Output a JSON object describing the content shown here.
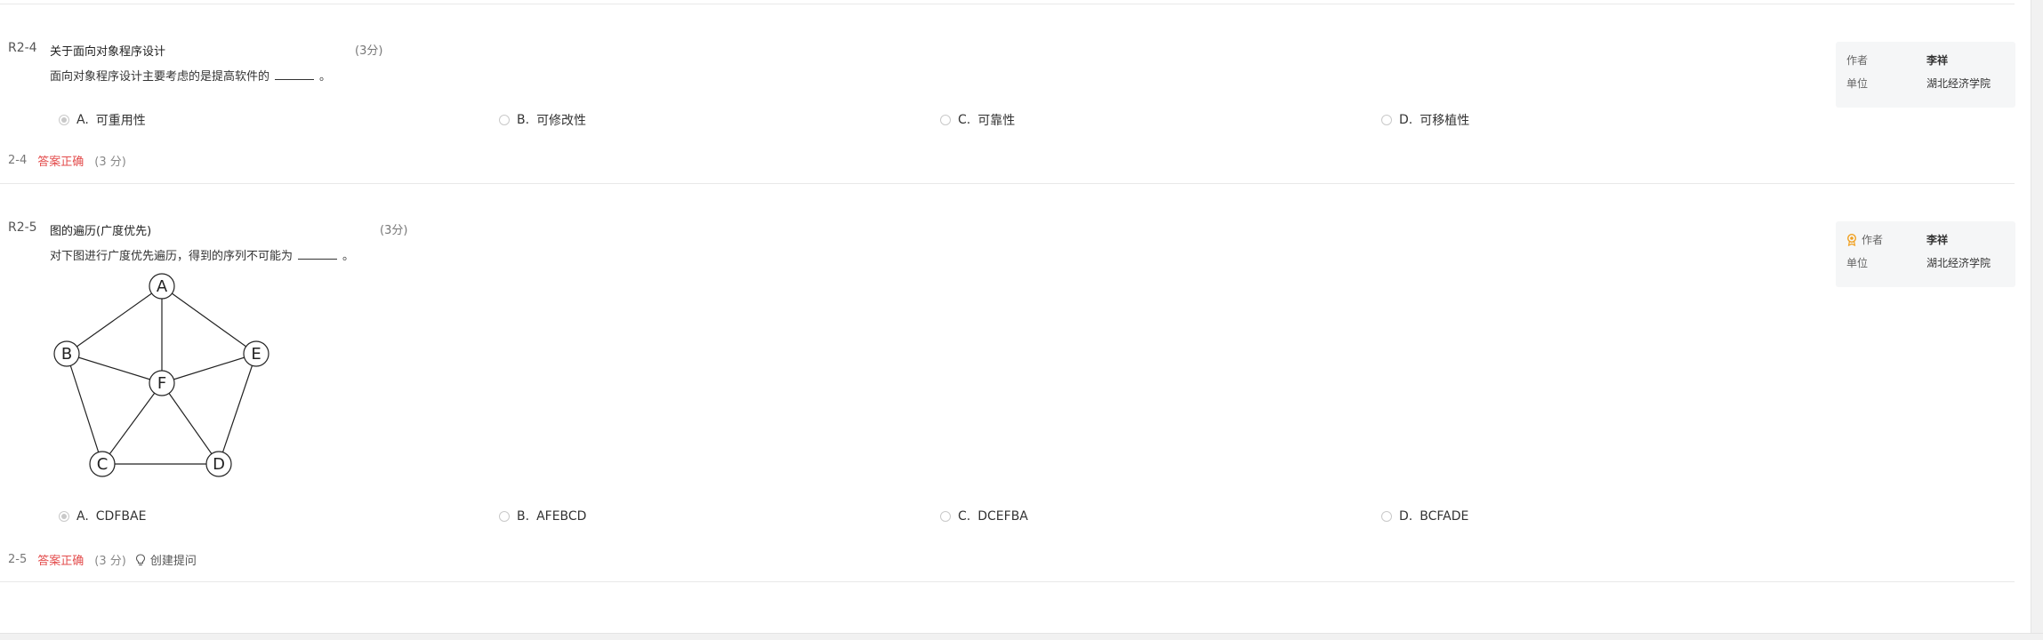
{
  "questions": [
    {
      "id": "R2-4",
      "title": "关于面向对象程序设计",
      "score": "(3分)",
      "text_before": "面向对象程序设计主要考虑的是提高软件的",
      "text_after": "。",
      "options": [
        {
          "letter": "A.",
          "text": "可重用性",
          "checked": true
        },
        {
          "letter": "B.",
          "text": "可修改性",
          "checked": false
        },
        {
          "letter": "C.",
          "text": "可靠性",
          "checked": false
        },
        {
          "letter": "D.",
          "text": "可移植性",
          "checked": false
        }
      ],
      "result": {
        "num": "2-4",
        "status": "答案正确",
        "score": "(3 分)"
      },
      "meta": {
        "author_label": "作者",
        "author": "李祥",
        "unit_label": "单位",
        "unit": "湖北经济学院"
      }
    },
    {
      "id": "R2-5",
      "title": "图的遍历(广度优先)",
      "score": "(3分)",
      "text_before": "对下图进行广度优先遍历，得到的序列不可能为",
      "text_after": "。",
      "graph": {
        "nodes": [
          "A",
          "B",
          "E",
          "F",
          "C",
          "D"
        ],
        "edges": [
          [
            "A",
            "B"
          ],
          [
            "A",
            "E"
          ],
          [
            "A",
            "F"
          ],
          [
            "B",
            "F"
          ],
          [
            "B",
            "C"
          ],
          [
            "E",
            "F"
          ],
          [
            "E",
            "D"
          ],
          [
            "F",
            "C"
          ],
          [
            "F",
            "D"
          ],
          [
            "C",
            "D"
          ]
        ]
      },
      "options": [
        {
          "letter": "A.",
          "text": "CDFBAE",
          "checked": true
        },
        {
          "letter": "B.",
          "text": "AFEBCD",
          "checked": false
        },
        {
          "letter": "C.",
          "text": "DCEFBA",
          "checked": false
        },
        {
          "letter": "D.",
          "text": "BCFADE",
          "checked": false
        }
      ],
      "result": {
        "num": "2-5",
        "status": "答案正确",
        "score": "(3 分)",
        "ask": "创建提问"
      },
      "meta": {
        "author_label": "作者",
        "author": "李祥",
        "unit_label": "单位",
        "unit": "湖北经济学院",
        "author_icon": "badge-icon"
      }
    }
  ],
  "colors": {
    "status_red": "#e34c4c",
    "badge_orange": "#f0a020",
    "meta_bg": "#f5f6f7"
  }
}
